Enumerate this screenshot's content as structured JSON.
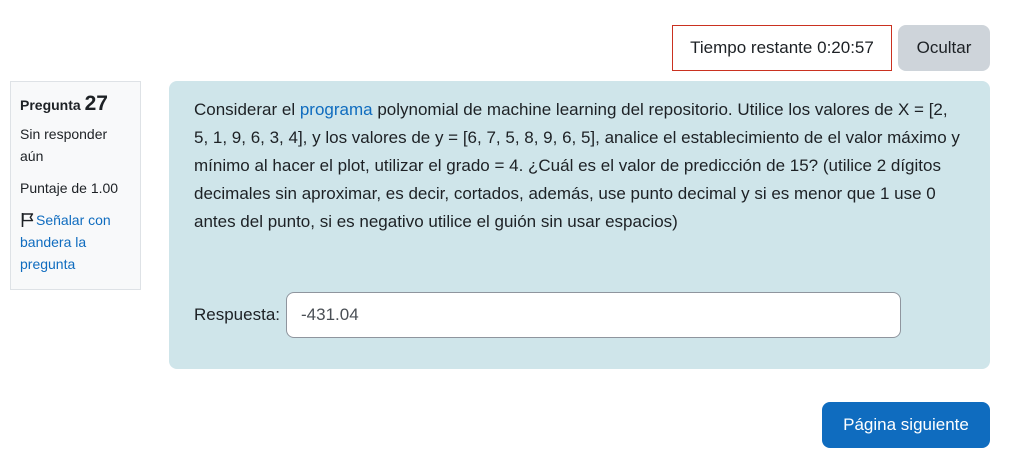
{
  "timer": {
    "label": "Tiempo restante",
    "value": "0:20:57"
  },
  "hide_button": "Ocultar",
  "question_info": {
    "title": "Pregunta",
    "number": "27",
    "state": "Sin responder aún",
    "grade": "Puntaje de 1.00",
    "flag_label": "Señalar con bandera la pregunta"
  },
  "question": {
    "text_before_link": "Considerar el ",
    "link_text": "programa",
    "text_after_link": " polynomial de machine learning del repositorio. Utilice los valores de X = [2, 5, 1, 9, 6, 3, 4], y los valores de y = [6, 7, 5, 8, 9, 6, 5], analice el establecimiento de el valor máximo y mínimo al hacer el plot, utilizar el grado = 4. ¿Cuál es el valor de predicción de 15? (utilice 2 dígitos decimales sin aproximar, es decir, cortados, además, use punto decimal y si es menor que 1 use 0 antes del punto, si es negativo utilice el guión sin usar espacios)",
    "answer_label": "Respuesta:",
    "answer_value": "-431.04"
  },
  "next_button": "Página siguiente",
  "colors": {
    "accent": "#0f6cbf",
    "question_bg": "#cfe5ea",
    "timer_border": "#ca3120"
  }
}
